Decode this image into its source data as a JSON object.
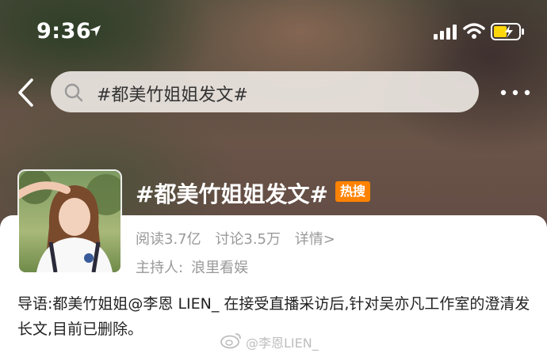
{
  "status_bar": {
    "time": "9:36"
  },
  "nav": {
    "search_value": "#都美竹姐姐发文#"
  },
  "topic": {
    "title": "#都美竹姐姐发文#",
    "badge": "热搜",
    "reads": "阅读3.7亿",
    "discussions": "讨论3.5万",
    "details": "详情>",
    "host_label": "主持人:",
    "host_name": "浪里看娱",
    "intro": "导语:都美竹姐姐@李恩 LIEN_ 在接受直播采访后,针对吴亦凡工作室的澄清发长文,目前已删除。"
  },
  "watermark": {
    "text": "@李恩LIEN_"
  },
  "colors": {
    "badge": "#ff8200",
    "meta_text": "#999999",
    "card_bg": "#ffffff"
  },
  "icons": [
    "location-arrow-icon",
    "signal-icon",
    "wifi-icon",
    "battery-charging-icon",
    "back-chevron-icon",
    "search-icon",
    "more-dots-icon",
    "weibo-logo-icon"
  ]
}
